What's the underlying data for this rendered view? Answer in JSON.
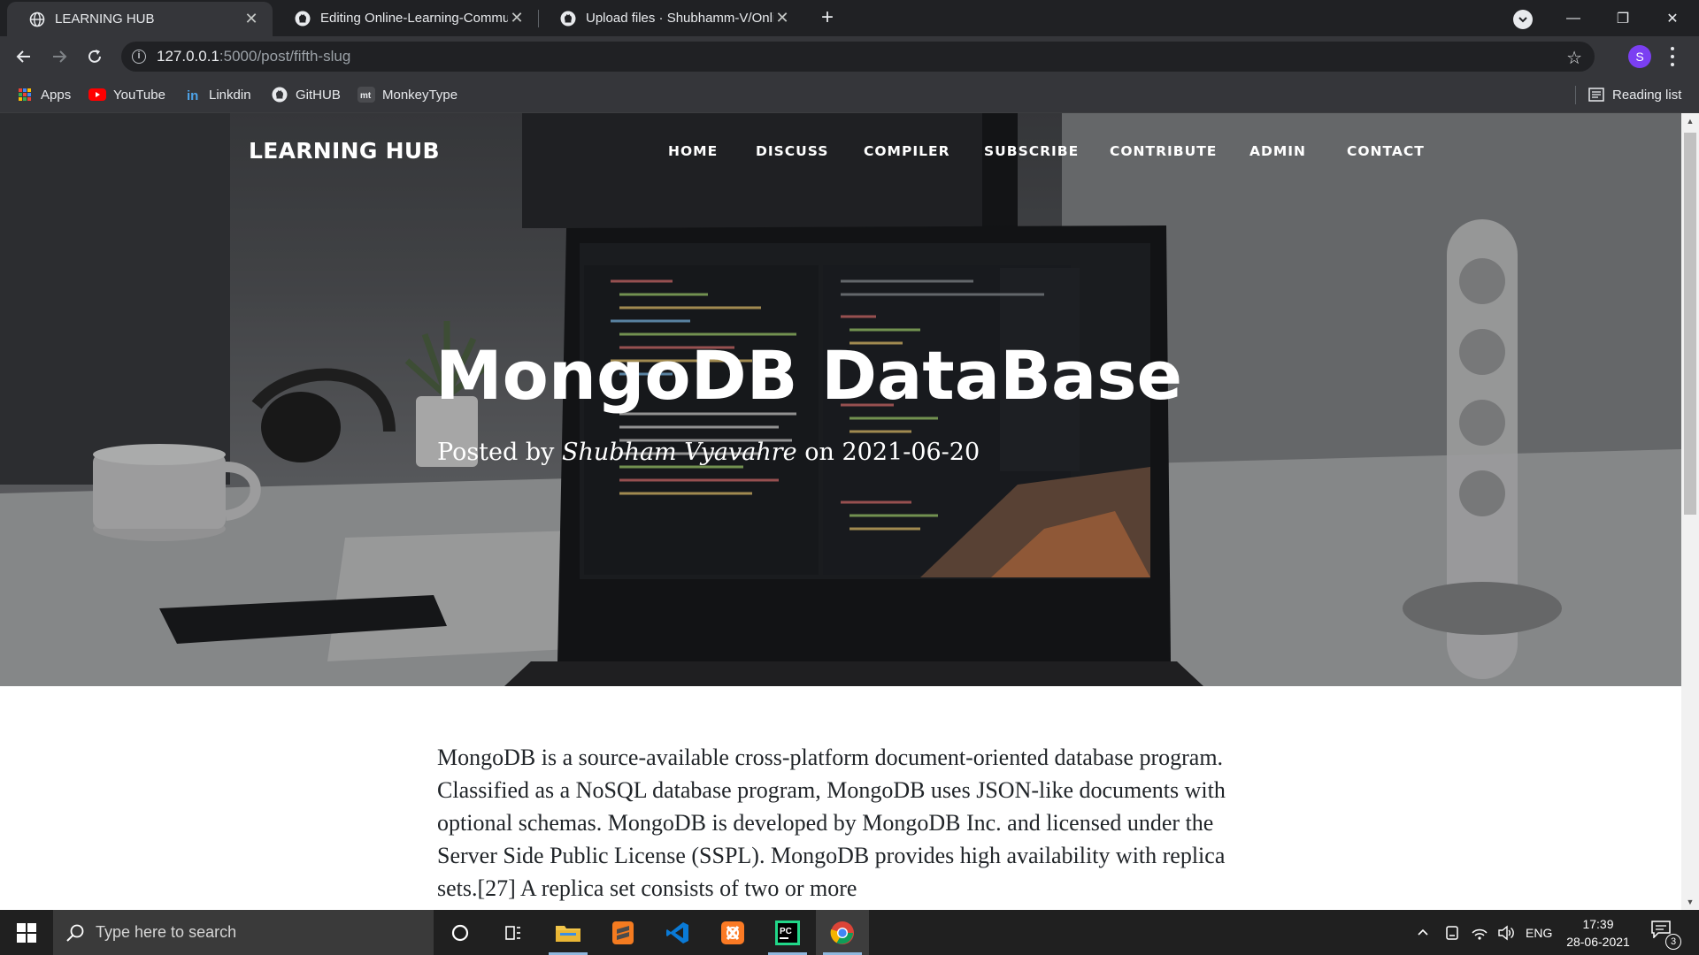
{
  "browser": {
    "tabs": [
      {
        "title": "LEARNING HUB",
        "icon": "globe-icon",
        "active": true
      },
      {
        "title": "Editing Online-Learning-Commu",
        "icon": "github-icon",
        "active": false
      },
      {
        "title": "Upload files · Shubhamm-V/Onli",
        "icon": "github-icon",
        "active": false
      }
    ],
    "new_tab": "+",
    "window_controls": {
      "minimize": "—",
      "maximize": "❐",
      "close": "✕"
    },
    "url_host": "127.0.0.1",
    "url_path": ":5000/post/fifth-slug",
    "profile_initial": "S",
    "bookmarks": [
      {
        "label": "Apps",
        "icon": "apps-grid-icon"
      },
      {
        "label": "YouTube",
        "icon": "youtube-icon"
      },
      {
        "label": "Linkdin",
        "icon": "linkedin-icon"
      },
      {
        "label": "GitHUB",
        "icon": "github-icon"
      },
      {
        "label": "MonkeyType",
        "icon": "monkeytype-icon"
      }
    ],
    "reading_list": "Reading list"
  },
  "site": {
    "brand": "LEARNING HUB",
    "nav": [
      "HOME",
      "DISCUSS",
      "COMPILER",
      "SUBSCRIBE",
      "CONTRIBUTE",
      "ADMIN",
      "CONTACT"
    ]
  },
  "post": {
    "title": "MongoDB DataBase",
    "meta_prefix": "Posted by",
    "author": "Shubham Vyavahre",
    "meta_on": "on",
    "date": "2021-06-20",
    "body": "MongoDB is a source-available cross-platform document-oriented database program. Classified as a NoSQL database program, MongoDB uses JSON-like documents with optional schemas. MongoDB is developed by MongoDB Inc. and licensed under the Server Side Public License (SSPL). MongoDB provides high availability with replica sets.[27] A replica set consists of two or more"
  },
  "taskbar": {
    "search_placeholder": "Type here to search",
    "apps": [
      "cortana-icon",
      "task-view-icon",
      "file-explorer-icon",
      "sublime-text-icon",
      "vscode-icon",
      "xampp-icon",
      "pycharm-icon",
      "chrome-icon"
    ],
    "language": "ENG",
    "time": "17:39",
    "date": "28-06-2021",
    "notifications": "3"
  },
  "colors": {
    "chrome_dark": "#202124",
    "chrome_toolbar": "#35363a",
    "taskbar": "#202020",
    "profile": "#7b3ff2"
  }
}
